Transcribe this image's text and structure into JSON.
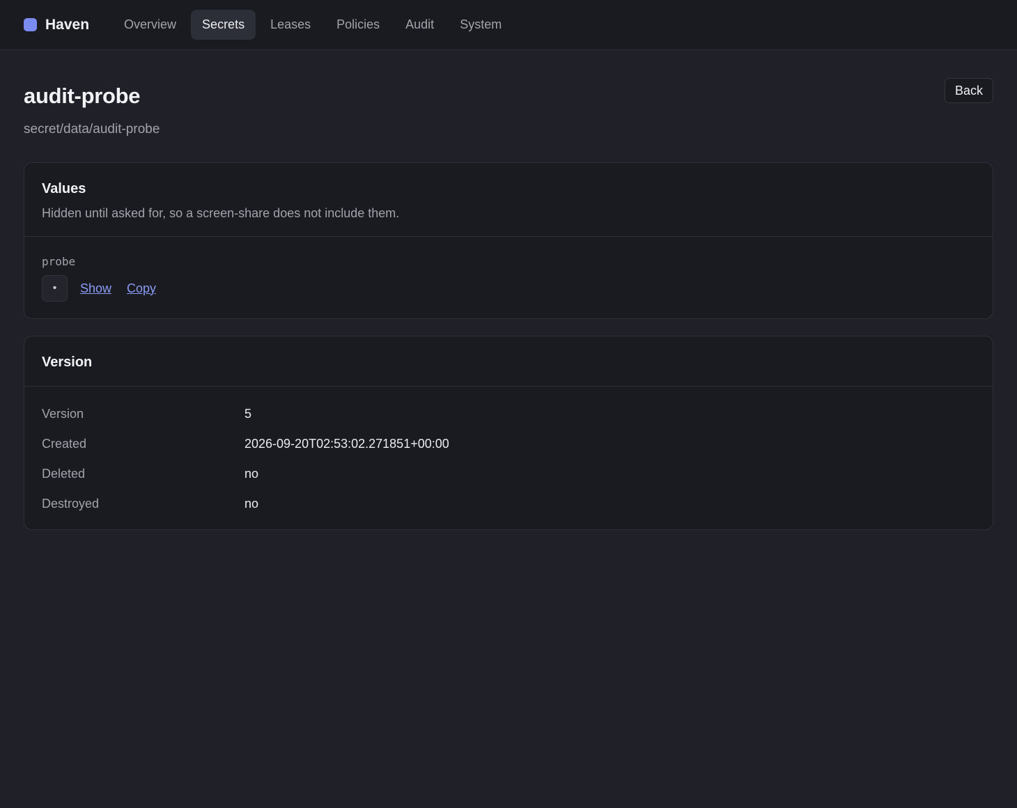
{
  "app": {
    "brand": "Haven",
    "nav": [
      {
        "label": "Overview",
        "active": false
      },
      {
        "label": "Secrets",
        "active": true
      },
      {
        "label": "Leases",
        "active": false
      },
      {
        "label": "Policies",
        "active": false
      },
      {
        "label": "Audit",
        "active": false
      },
      {
        "label": "System",
        "active": false
      }
    ],
    "brand_color": "#7a8cf0"
  },
  "page": {
    "title": "audit-probe",
    "path": "secret/data/audit-probe",
    "back_label": "Back"
  },
  "values_card": {
    "title": "Values",
    "description": "Hidden until asked for, so a screen-share does not include them.",
    "secrets": [
      {
        "key": "probe",
        "masked": "•",
        "show_label": "Show",
        "copy_label": "Copy"
      }
    ]
  },
  "version_card": {
    "title": "Version",
    "rows": [
      {
        "label": "Version",
        "value": "5"
      },
      {
        "label": "Created",
        "value": "2026-09-20T02:53:02.271851+00:00"
      },
      {
        "label": "Deleted",
        "value": "no"
      },
      {
        "label": "Destroyed",
        "value": "no"
      }
    ]
  }
}
